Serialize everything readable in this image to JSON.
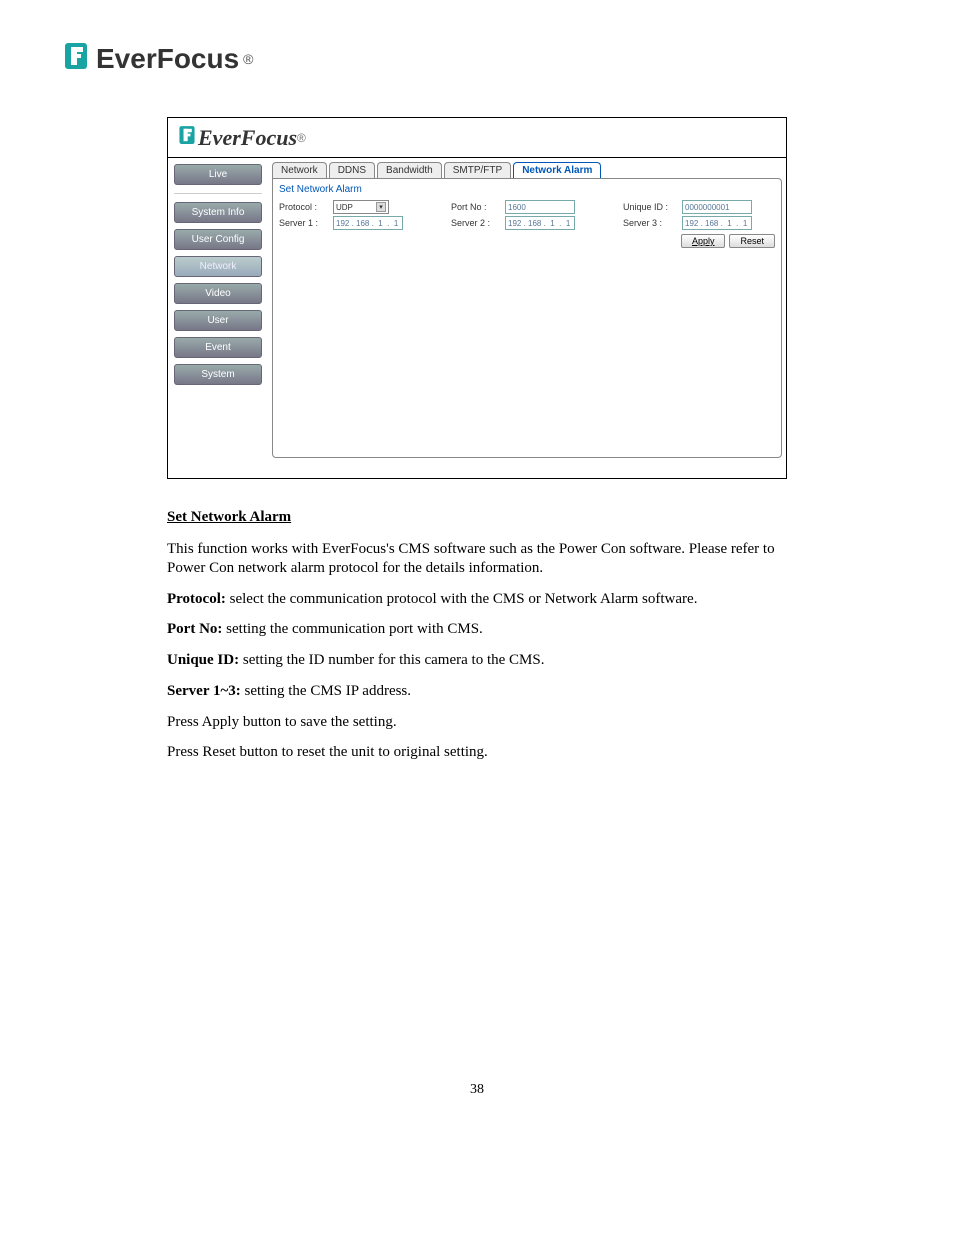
{
  "header": {
    "brand": "EverFocus"
  },
  "app": {
    "brand": "EverFocus",
    "sidebar": {
      "live": "Live",
      "system_info": "System Info",
      "user_config": "User Config",
      "network": "Network",
      "video": "Video",
      "user": "User",
      "event": "Event",
      "system": "System"
    },
    "tabs": {
      "network": "Network",
      "ddns": "DDNS",
      "bandwidth": "Bandwidth",
      "smtpftp": "SMTP/FTP",
      "network_alarm": "Network Alarm"
    },
    "panel": {
      "title": "Set Network Alarm",
      "protocol_label": "Protocol :",
      "protocol_value": "UDP",
      "portno_label": "Port No :",
      "portno_value": "1600",
      "uniqueid_label": "Unique ID :",
      "uniqueid_value": "0000000001",
      "server1_label": "Server 1 :",
      "server1_value": "192 . 168 .  1  .  1",
      "server2_label": "Server 2 :",
      "server2_value": "192 . 168 .  1  .  1",
      "server3_label": "Server 3 :",
      "server3_value": "192 . 168 .  1  .  1",
      "apply": "Apply",
      "reset": "Reset"
    }
  },
  "doc": {
    "section_title": "Set Network Alarm",
    "intro": "This function works with EverFocus's CMS software such as the Power Con software. Please refer to Power Con network alarm protocol for the details information.",
    "protocol_label": "Protocol:",
    "protocol_text": " select the communication protocol with the CMS or Network Alarm software.",
    "portno_label": "Port No:",
    "portno_text": " setting the communication port with CMS.",
    "uniqueid_label": "Unique ID:",
    "uniqueid_text": " setting the ID number for this camera to the CMS.",
    "server_label": "Server 1~3:",
    "server_text": " setting the CMS IP address.",
    "apply": "Press Apply button to save the setting.",
    "reset": "Press Reset button to reset the unit to original setting."
  },
  "footer": {
    "page": "38"
  }
}
